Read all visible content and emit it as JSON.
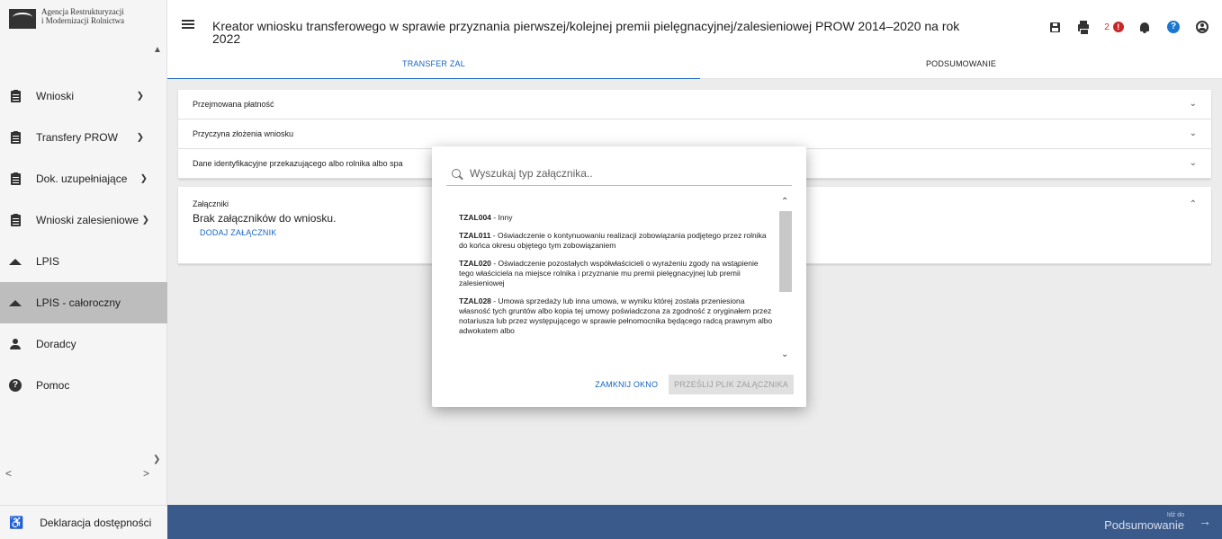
{
  "logo": {
    "line1": "Agencja Restrukturyzacji",
    "line2": "i Modernizacji Rolnictwa"
  },
  "header": {
    "title": "Kreator wniosku transferowego w sprawie przyznania pierwszej/kolejnej premii pielęgnacyjnej/zalesieniowej PROW 2014–2020 na rok 2022",
    "error_count": "2"
  },
  "toolbar_icons": [
    "save-icon",
    "print-icon",
    "error-icon",
    "bell-icon",
    "help-icon",
    "account-icon"
  ],
  "tabs": [
    {
      "label": "TRANSFER ZAL",
      "active": true
    },
    {
      "label": "PODSUMOWANIE",
      "active": false
    }
  ],
  "sidebar": {
    "items": [
      {
        "label": "Wnioski",
        "icon": "clipboard-icon",
        "has_chevron": true
      },
      {
        "label": "Transfery PROW",
        "icon": "clipboard-icon",
        "has_chevron": true
      },
      {
        "label": "Dok. uzupełniające",
        "icon": "clipboard-icon",
        "has_chevron": true
      },
      {
        "label": "Wnioski zalesieniowe",
        "icon": "clipboard-icon",
        "has_chevron": true
      },
      {
        "label": "LPIS",
        "icon": "mountain-icon",
        "has_chevron": false
      },
      {
        "label": "LPIS - całoroczny",
        "icon": "mountain-icon",
        "has_chevron": false,
        "active": true
      },
      {
        "label": "Doradcy",
        "icon": "person-icon",
        "has_chevron": false
      },
      {
        "label": "Pomoc",
        "icon": "help-icon",
        "has_chevron": false
      }
    ],
    "accessibility": "Deklaracja dostępności"
  },
  "panels": [
    {
      "label": "Przejmowana płatność"
    },
    {
      "label": "Przyczyna złożenia wniosku"
    },
    {
      "label": "Dane identyfikacyjne przekazującego albo rolnika albo spa"
    }
  ],
  "attachments": {
    "label": "Załączniki",
    "none_text": "Brak załączników do wniosku.",
    "add_label": "DODAJ ZAŁĄCZNIK"
  },
  "footer": {
    "goto_small": "Idź do",
    "goto_big": "Podsumowanie"
  },
  "modal": {
    "search_placeholder": "Wyszukaj typ załącznika..",
    "options": [
      {
        "code": "TZAL004",
        "text": " - Inny"
      },
      {
        "code": "TZAL011",
        "text": " - Oświadczenie o kontynuowaniu realizacji zobowiązania podjętego przez rolnika do końca okresu objętego tym zobowiązaniem"
      },
      {
        "code": "TZAL020",
        "text": " - Oświadczenie pozostałych współwłaścicieli o wyrażeniu zgody na wstąpienie tego właściciela na miejsce rolnika i przyznanie mu premii pielęgnacyjnej lub premii zalesieniowej"
      },
      {
        "code": "TZAL028",
        "text": " - Umowa sprzedaży lub inna umowa, w wyniku której została przeniesiona własność tych gruntów albo kopia tej umowy poświadczona za zgodność z oryginałem przez notariusza lub przez występującego w sprawie pełnomocnika będącego radcą prawnym albo adwokatem albo"
      }
    ],
    "close_label": "ZAMKNIJ OKNO",
    "send_label": "PRZEŚLIJ PLIK ZAŁĄCZNIKA"
  }
}
